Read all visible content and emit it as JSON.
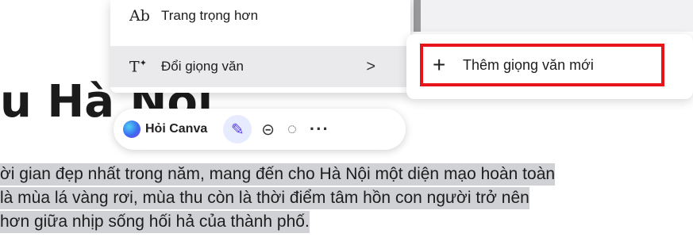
{
  "document": {
    "heading": "u Hà Nội",
    "paragraph_lines": [
      "ời gian đẹp nhất trong năm, mang đến cho Hà Nội một diện mạo hoàn toàn",
      " là mùa lá vàng rơi, mùa thu còn là thời điểm tâm hồn con người trở nên",
      "hơn giữa nhịp sống hối hả của thành phố."
    ]
  },
  "menu": {
    "items": [
      {
        "icon": "Ab",
        "icon_name": "text-style-icon",
        "label": "Trang trọng hơn"
      },
      {
        "icon": "T*",
        "icon_name": "change-voice-icon",
        "label": "Đổi giọng văn",
        "chevron": ">"
      }
    ]
  },
  "submenu": {
    "plus_icon": "+",
    "add_voice_label": "Thêm giọng văn mới",
    "highlight_color": "#e8141b"
  },
  "toolbar": {
    "ask_canva_label": "Hỏi Canva",
    "icons": [
      "canva-logo-icon",
      "magic-write-icon",
      "link-icon",
      "comment-add-icon",
      "more-icon"
    ]
  }
}
